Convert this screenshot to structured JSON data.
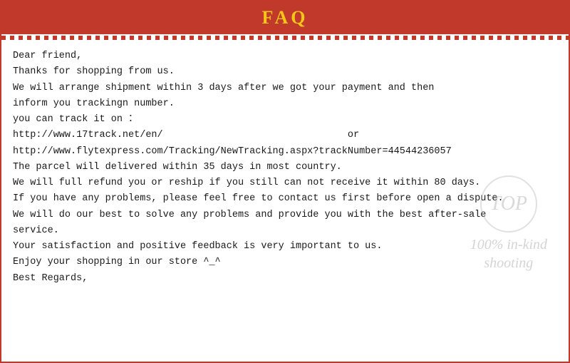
{
  "header": {
    "title": "FAQ"
  },
  "content": {
    "line1": "Dear friend,",
    "line2": "Thanks for shopping from us.",
    "line3": "We will arrange shipment within 3 days after we got your payment and then",
    "line4": "inform you trackingn number.",
    "line5": "you can track it on ：",
    "line6a": "http://www.17track.net/en/",
    "line6b": "or",
    "line7": "http://www.flytexpress.com/Tracking/NewTracking.aspx?trackNumber=44544236057",
    "line8": "The parcel will delivered within 35 days in most country.",
    "line9": "We will full refund you or reship if you still can not receive it within 80 days.",
    "line10": "If you have any problems, please feel free to contact us first before open a dispute.",
    "line11": "We will do our best to solve any problems and provide you with the best after-sale",
    "line12": "service.",
    "line13": "Your satisfaction and positive feedback is very important to us.",
    "line14": "Enjoy your shopping in our store ^_^",
    "line15": "Best Regards,"
  },
  "watermark": {
    "circle_text": "TOP",
    "line1": "100% in-kind",
    "line2": "shooting"
  }
}
